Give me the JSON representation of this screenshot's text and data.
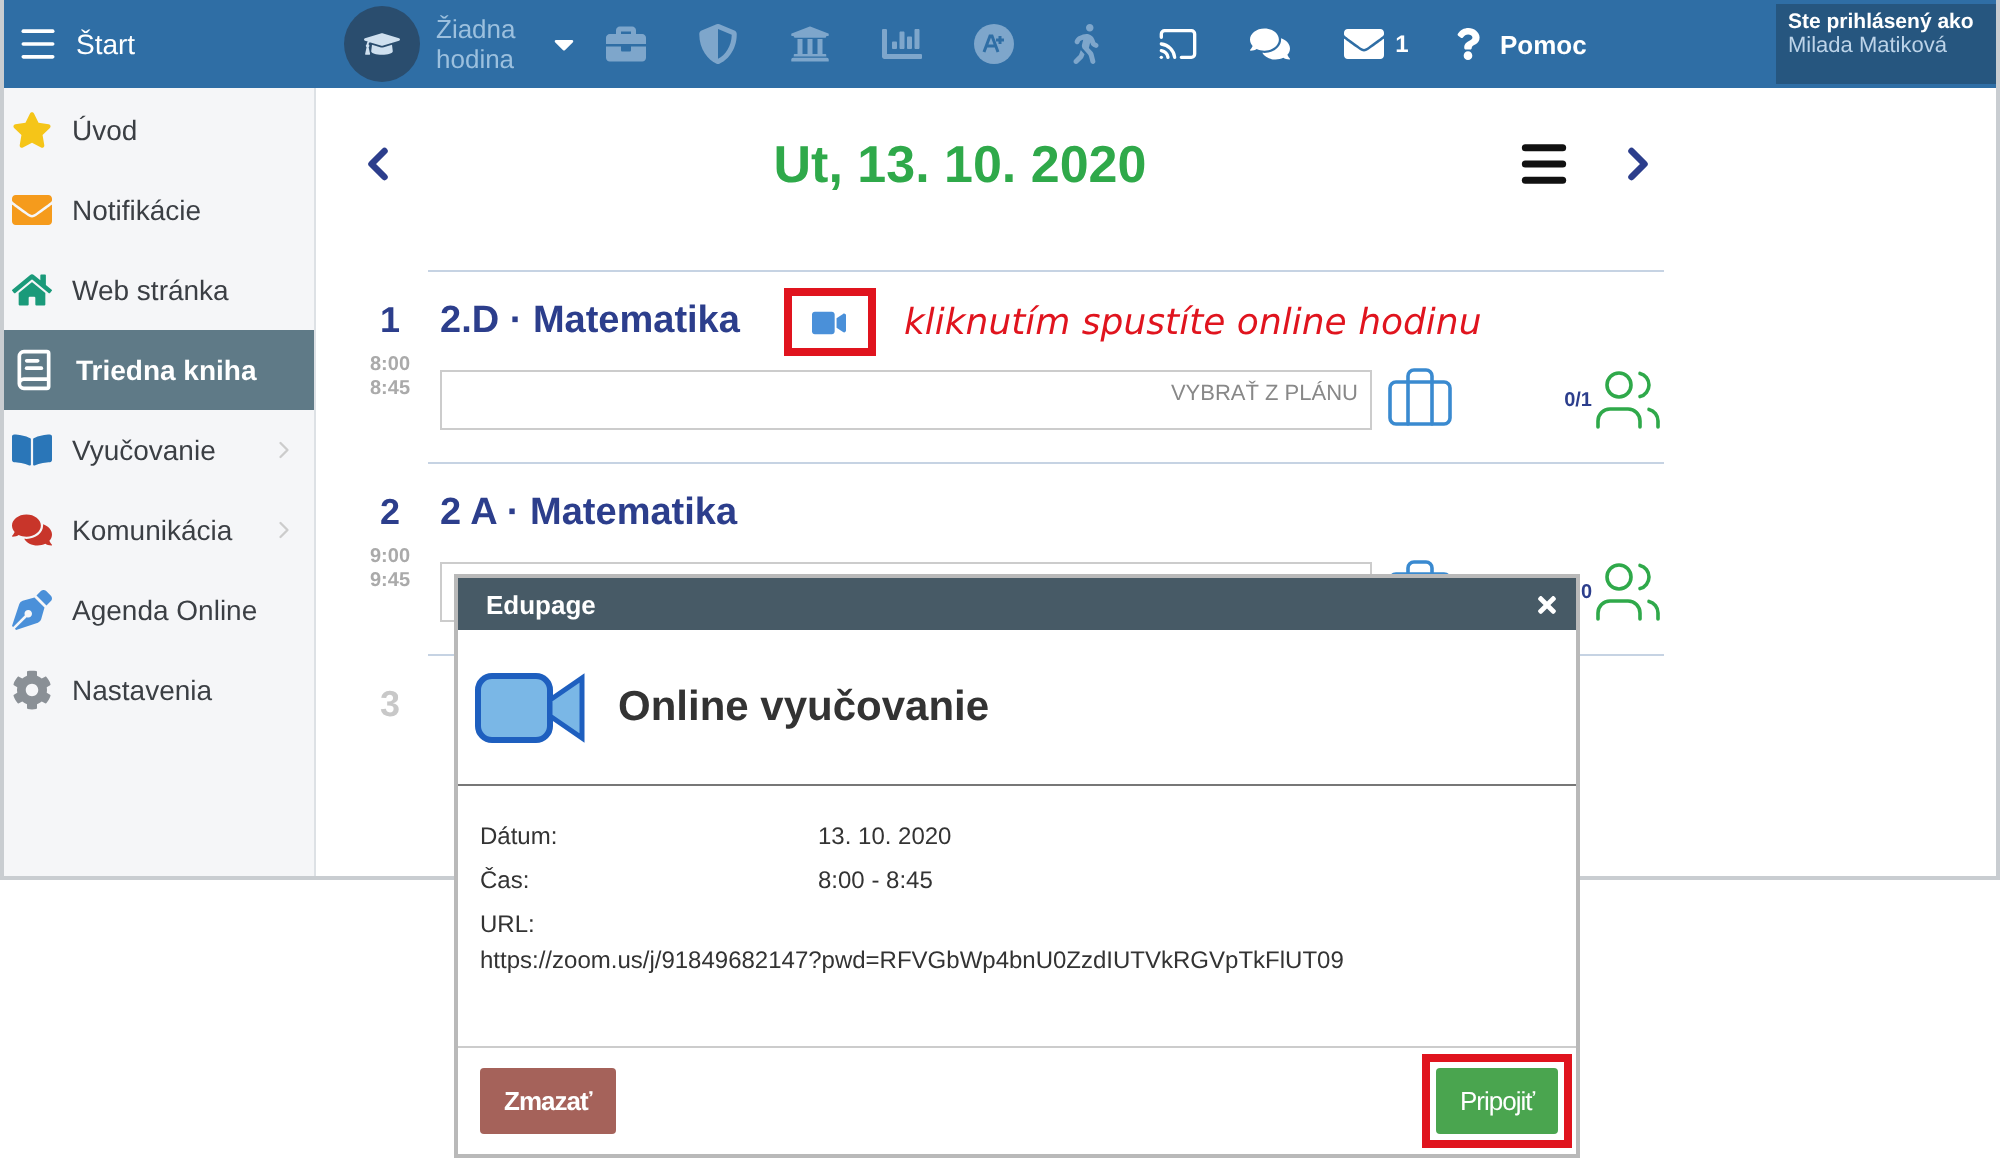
{
  "topbar": {
    "menu_label": "Štart",
    "lesson_select": "Žiadna hodina",
    "mail_count": "1",
    "help_label": "Pomoc",
    "user_caption": "Ste prihlásený ako",
    "user_name": "Milada Matiková"
  },
  "sidebar": {
    "items": [
      {
        "label": "Úvod",
        "selected": false,
        "submenu": false
      },
      {
        "label": "Notifikácie",
        "selected": false,
        "submenu": false
      },
      {
        "label": "Web stránka",
        "selected": false,
        "submenu": false
      },
      {
        "label": "Triedna kniha",
        "selected": true,
        "submenu": false
      },
      {
        "label": "Vyučovanie",
        "selected": false,
        "submenu": true
      },
      {
        "label": "Komunikácia",
        "selected": false,
        "submenu": true
      },
      {
        "label": "Agenda Online",
        "selected": false,
        "submenu": false
      },
      {
        "label": "Nastavenia",
        "selected": false,
        "submenu": false
      }
    ]
  },
  "date_header": "Ut, 13. 10. 2020",
  "lessons": [
    {
      "number": "1",
      "title": "2.D · Matematika",
      "start": "8:00",
      "end": "8:45",
      "plan_placeholder": "VYBRAŤ Z PLÁNU",
      "count": "0/1",
      "online": true,
      "dimmed": false
    },
    {
      "number": "2",
      "title": "2 A · Matematika",
      "start": "9:00",
      "end": "9:45",
      "count": "0",
      "online": false,
      "dimmed": false
    },
    {
      "number": "3",
      "online": false,
      "dimmed": true
    }
  ],
  "annotation": {
    "text": "kliknutím spustíte online hodinu"
  },
  "dialog": {
    "title": "Edupage",
    "heading": "Online vyučovanie",
    "fields": [
      {
        "label": "Dátum:",
        "value": "13. 10. 2020"
      },
      {
        "label": "Čas:",
        "value": "8:00 - 8:45"
      }
    ],
    "url_label": "URL:",
    "url": "https://zoom.us/j/91849682147?pwd=RFVGbWp4bnU0ZzdIUTVkRGVpTkFlUT09",
    "delete_button": "Zmazať",
    "join_button": "Pripojiť",
    "join_highlighted": true
  }
}
